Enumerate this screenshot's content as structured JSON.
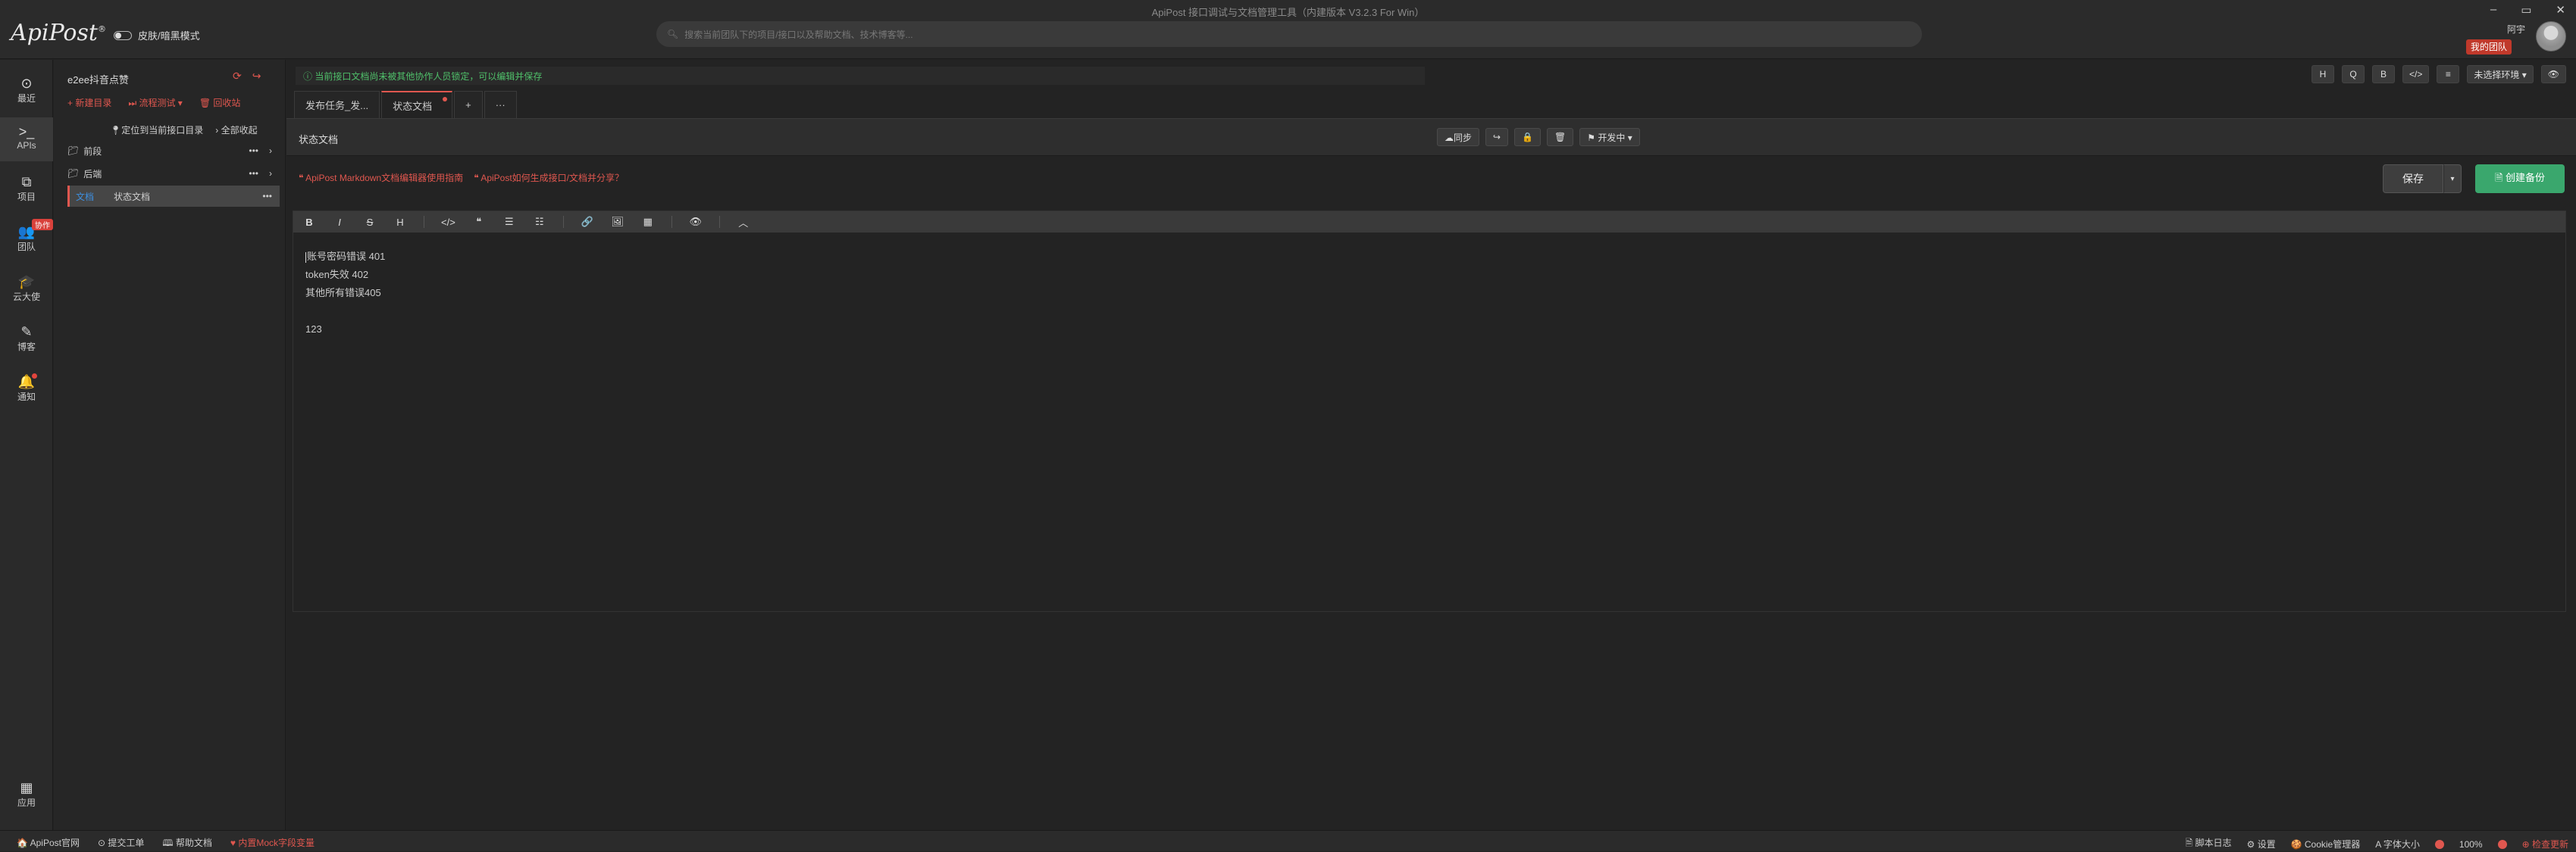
{
  "app": {
    "title": "ApiPost 接口调试与文档管理工具（内建版本 V3.2.3 For Win）",
    "logo": "ApiPost",
    "logo_reg": "®",
    "theme_toggle_label": "皮肤/暗黑模式",
    "search_placeholder": "搜索当前团队下的项目/接口以及帮助文档、技术博客等...",
    "window_controls": [
      "–",
      "▭",
      "✕"
    ],
    "user_name": "阿宇",
    "team_badge": "我的团队"
  },
  "leftnav": {
    "items": [
      {
        "icon": "clock-icon",
        "glyph": "⊙",
        "label": "最近"
      },
      {
        "icon": "terminal-icon",
        "glyph": ">_",
        "label": "APIs"
      },
      {
        "icon": "project-icon",
        "glyph": "⧉",
        "label": "项目"
      },
      {
        "icon": "team-icon",
        "glyph": "👥",
        "label": "团队",
        "badge": "协作"
      },
      {
        "icon": "graduation-cap-icon",
        "glyph": "🎓",
        "label": "云大使"
      },
      {
        "icon": "edit-icon",
        "glyph": "✎",
        "label": "博客"
      },
      {
        "icon": "bell-icon",
        "glyph": "🔔",
        "label": "通知"
      }
    ],
    "apps": {
      "icon": "apps-grid-icon",
      "glyph": "▦",
      "label": "应用"
    }
  },
  "tree": {
    "project_name": "e2ee抖音点赞",
    "actions": [
      "+ 新建目录",
      "⏭ 流程测试 ▾",
      "🗑 回收站"
    ],
    "locate_label": "定位到当前接口目录",
    "collapse_label": "全部收起",
    "rows": [
      {
        "type": "folder",
        "label": "前段"
      },
      {
        "type": "folder",
        "label": "后端"
      },
      {
        "type": "doc",
        "tag": "文档",
        "label": "状态文档"
      }
    ],
    "row_more": "•••",
    "row_arrow": "›"
  },
  "notice": "ⓘ 当前接口文档尚未被其他协作人员锁定，可以编辑并保存",
  "right_tools": [
    "H",
    "Q",
    "B",
    "</>",
    "≡",
    "未选择环境 ▾",
    "👁"
  ],
  "tabs": [
    {
      "label": "发布任务_发...",
      "active": false,
      "unsaved": false
    },
    {
      "label": "状态文档",
      "active": true,
      "unsaved": true
    }
  ],
  "tab_add": "+",
  "tab_more": "···",
  "docbar": {
    "title": "状态文档",
    "sync": "☁同步",
    "share": "↪",
    "lock": "🔒",
    "delete": "🗑",
    "status": "⚑ 开发中 ▾"
  },
  "help_links": [
    "❝ ApiPost Markdown文档编辑器使用指南",
    "❝ ApiPost如何生成接口/文档并分享？"
  ],
  "save": "保存",
  "save_drop": "▾",
  "backup": "🗎 创建备份",
  "md_toolbar": [
    "B",
    "I",
    "S",
    "H",
    "|",
    "</>",
    "❝",
    "☰",
    "☷",
    "|",
    "🔗",
    "🖼",
    "▦",
    "|",
    "👁",
    "|",
    "︿"
  ],
  "editor_lines": [
    "账号密码错误 401",
    "token失效 402",
    "其他所有错误405",
    "",
    "123"
  ],
  "statusbar": {
    "left": [
      "🏠 ApiPost官网",
      "⊙ 提交工单",
      "🕮 帮助文档",
      "♥ 内置Mock字段变量"
    ],
    "right": [
      "🗎 脚本日志",
      "⚙ 设置",
      "🍪 Cookie管理器",
      "A 字体大小",
      "100%",
      "⊕ 检查更新"
    ]
  },
  "colors": {
    "accent": "#e0574f",
    "success": "#3aa76d",
    "notice": "#4fc06a",
    "doc_tag": "#3d8fe0"
  }
}
